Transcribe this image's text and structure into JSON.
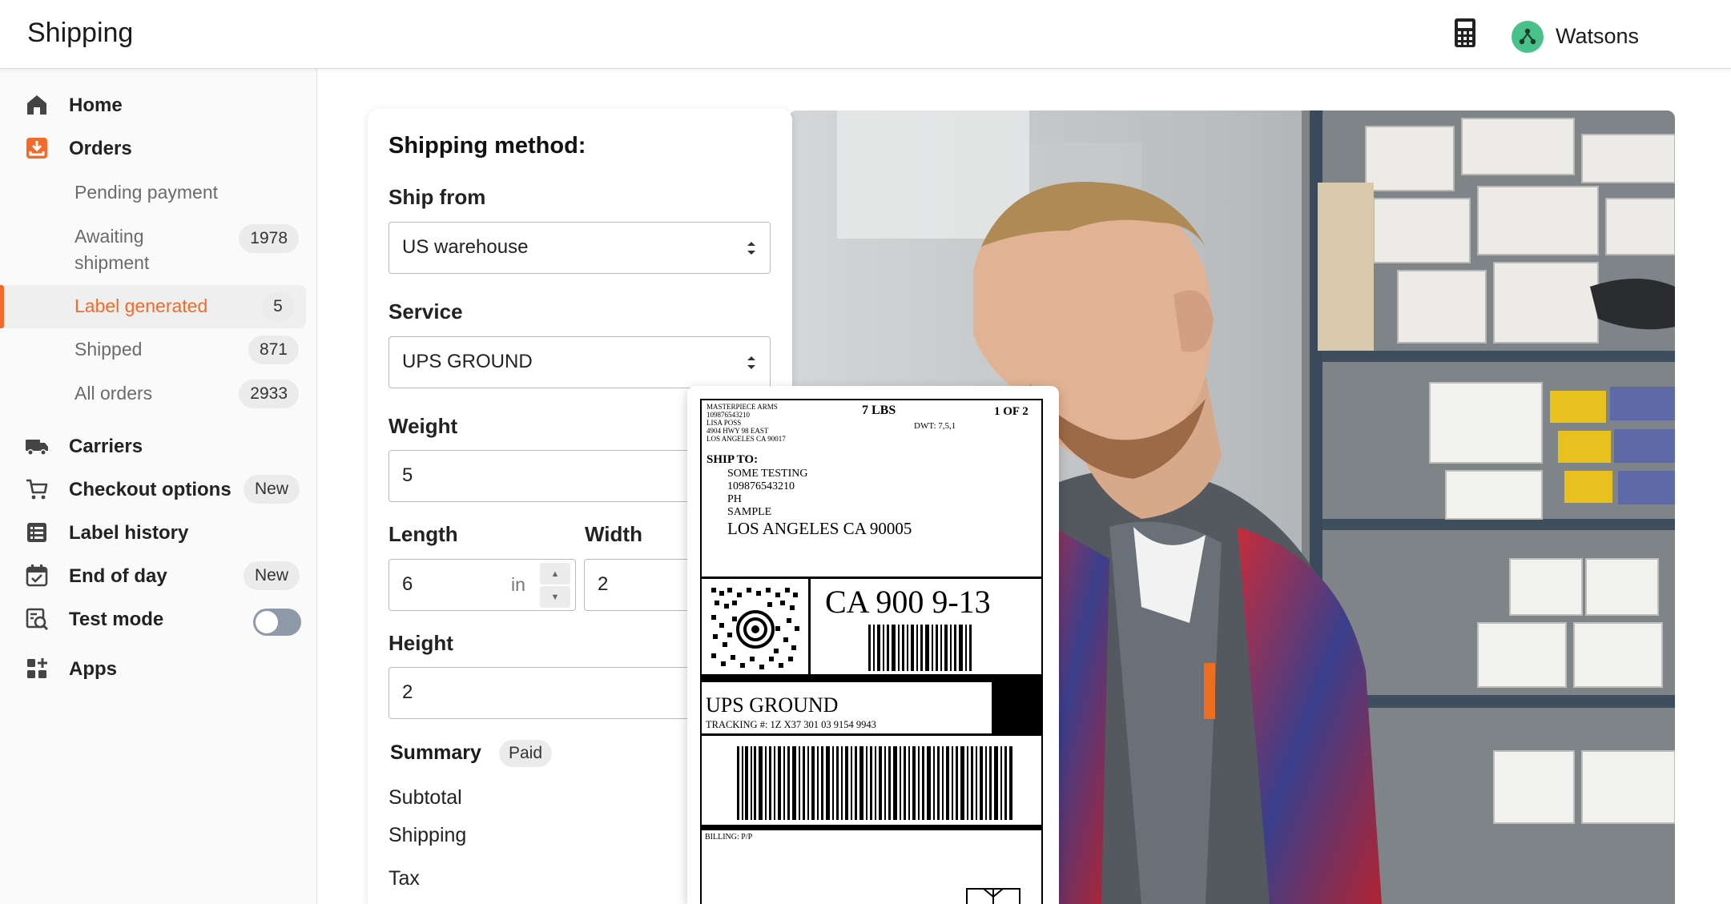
{
  "header": {
    "title": "Shipping",
    "user_name": "Watsons",
    "accent_color": "#f26b2a"
  },
  "sidebar": {
    "home": "Home",
    "orders": "Orders",
    "orders_sub": [
      {
        "label": "Pending payment",
        "count": ""
      },
      {
        "label": "Awaiting shipment",
        "count": "1978"
      },
      {
        "label": "Label generated",
        "count": "5",
        "active": true
      },
      {
        "label": "Shipped",
        "count": "871"
      },
      {
        "label": "All orders",
        "count": "2933"
      }
    ],
    "carriers": "Carriers",
    "checkout_options": "Checkout options",
    "checkout_badge": "New",
    "label_history": "Label history",
    "end_of_day": "End of day",
    "end_of_day_badge": "New",
    "test_mode": "Test mode",
    "test_mode_on": false,
    "apps": "Apps"
  },
  "form": {
    "title": "Shipping method:",
    "ship_from_label": "Ship from",
    "ship_from_value": "US warehouse",
    "service_label": "Service",
    "service_value": "UPS GROUND",
    "weight_label": "Weight",
    "weight_value": "5",
    "length_label": "Length",
    "length_value": "6",
    "length_unit": "in",
    "width_label": "Width",
    "width_value": "2",
    "height_label": "Height",
    "height_value": "2",
    "summary_label": "Summary",
    "summary_badge": "Paid",
    "subtotal_label": "Subtotal",
    "shipping_label": "Shipping",
    "tax_label": "Tax"
  },
  "shipping_label": {
    "sender_lines": [
      "MASTERPIECE ARMS",
      "109876543210",
      "LISA POSS",
      "4904 HWY 98 EAST",
      "LOS ANGELES  CA 90017"
    ],
    "weight": "7 LBS",
    "pages": "1 OF 2",
    "dwt": "DWT: 7,5,1",
    "ship_to_heading": "SHIP TO:",
    "ship_to_lines": [
      "SOME TESTING",
      "109876543210",
      "PH",
      "SAMPLE"
    ],
    "ship_to_city": "LOS ANGELES  CA 90005",
    "route_code": "CA 900 9-13",
    "service": "UPS GROUND",
    "tracking": "TRACKING #: 1Z X37 301 03 9154 9943",
    "billing": "BILLING: P/P"
  }
}
